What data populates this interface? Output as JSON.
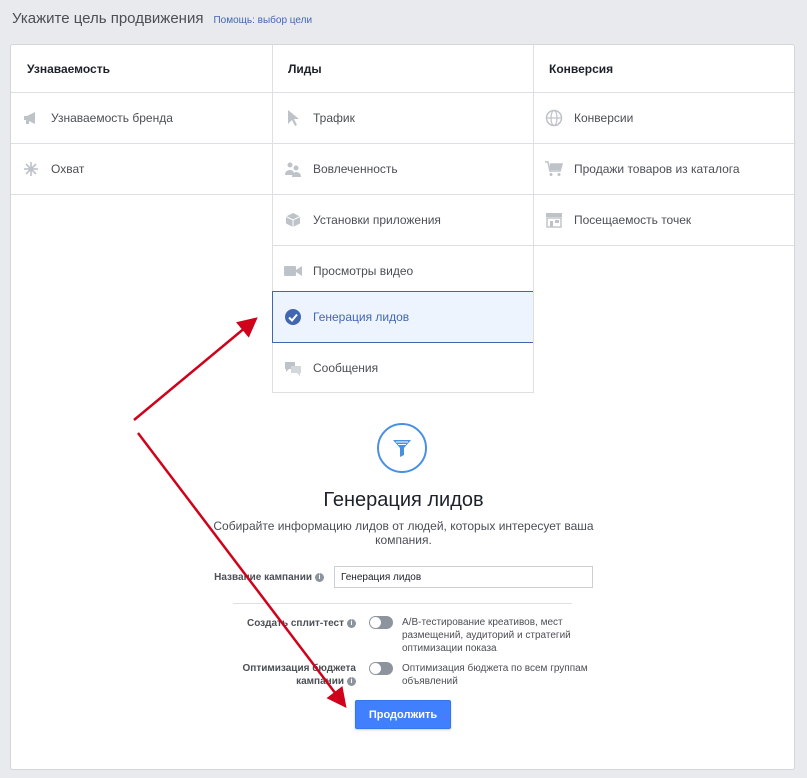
{
  "header": {
    "title": "Укажите цель продвижения",
    "help_link": "Помощь: выбор цели"
  },
  "columns": [
    {
      "title": "Узнаваемость",
      "items": [
        {
          "label": "Узнаваемость бренда",
          "icon": "megaphone-icon"
        },
        {
          "label": "Охват",
          "icon": "reach-icon"
        }
      ]
    },
    {
      "title": "Лиды",
      "items": [
        {
          "label": "Трафик",
          "icon": "cursor-icon"
        },
        {
          "label": "Вовлеченность",
          "icon": "people-icon"
        },
        {
          "label": "Установки приложения",
          "icon": "box-icon"
        },
        {
          "label": "Просмотры видео",
          "icon": "video-camera-icon"
        },
        {
          "label": "Генерация лидов",
          "icon": "check-circle-icon",
          "selected": true
        },
        {
          "label": "Сообщения",
          "icon": "chat-bubbles-icon"
        }
      ]
    },
    {
      "title": "Конверсия",
      "items": [
        {
          "label": "Конверсии",
          "icon": "globe-icon"
        },
        {
          "label": "Продажи товаров из каталога",
          "icon": "cart-icon"
        },
        {
          "label": "Посещаемость точек",
          "icon": "store-icon"
        }
      ]
    }
  ],
  "detail": {
    "icon": "funnel-icon",
    "title": "Генерация лидов",
    "description": "Собирайте информацию лидов от людей, которых интересует ваша компания.",
    "campaign_name_label": "Название кампании",
    "campaign_name_value": "Генерация лидов",
    "split_test_label": "Создать сплит-тест",
    "split_test_desc": "A/B-тестирование креативов, мест размещений, аудиторий и стратегий оптимизации показа",
    "budget_label": "Оптимизация бюджета кампании",
    "budget_desc": "Оптимизация бюджета по всем группам объявлений",
    "continue_button": "Продолжить"
  },
  "colors": {
    "accent": "#4267b2",
    "button": "#4080ff",
    "arrow": "#d0021b",
    "selected_bg": "#edf4fd"
  }
}
